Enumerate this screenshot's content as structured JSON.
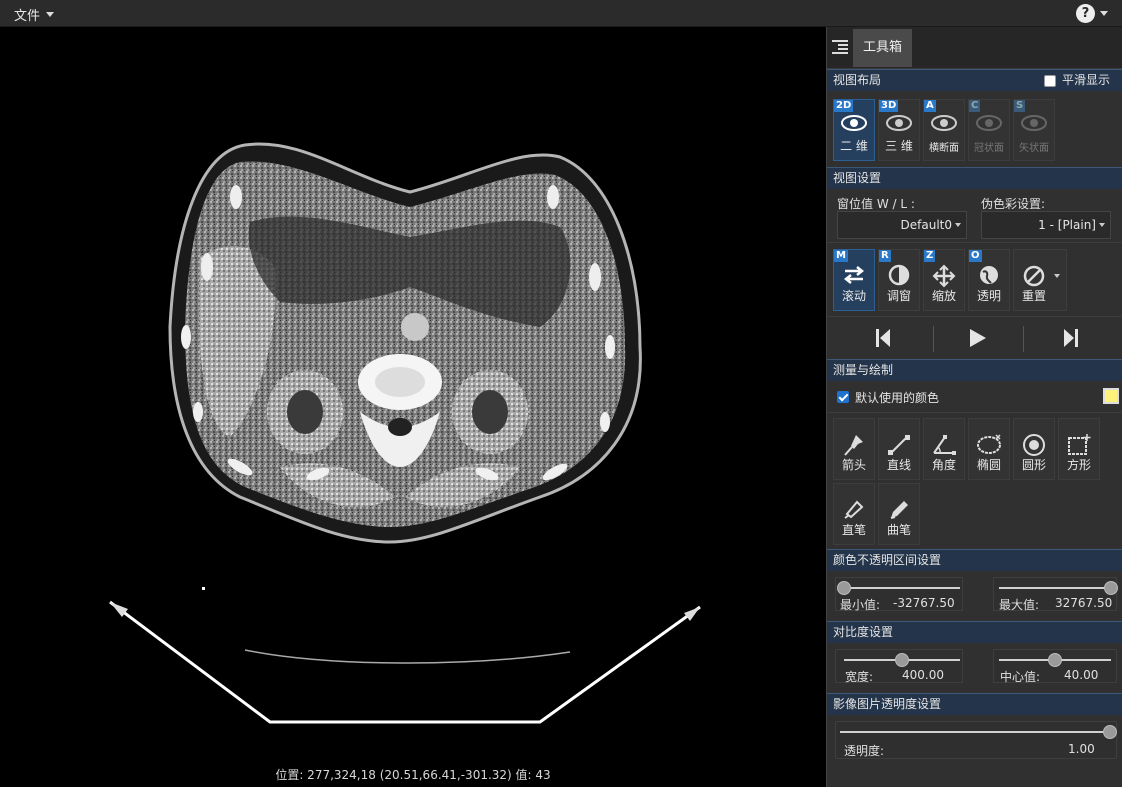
{
  "menubar": {
    "file_label": "文件",
    "help_icon": "question-circle-icon"
  },
  "viewer": {
    "status_text": "位置: 277,324,18 (20.51,66.41,-301.32) 值: 43"
  },
  "panel": {
    "tab_label": "工具箱",
    "view_layout": {
      "title": "视图布局",
      "smooth_label": "平滑显示",
      "smooth_checked": false,
      "modes": [
        {
          "badge": "2D",
          "label": "二 维",
          "icon": "eye-icon",
          "active": true,
          "enabled": true
        },
        {
          "badge": "3D",
          "label": "三 维",
          "icon": "eye-icon",
          "active": false,
          "enabled": true
        },
        {
          "badge": "A",
          "label": "横断面",
          "icon": "eye-icon",
          "active": false,
          "enabled": true
        },
        {
          "badge": "C",
          "label": "冠状面",
          "icon": "eye-icon",
          "active": false,
          "enabled": false
        },
        {
          "badge": "S",
          "label": "矢状面",
          "icon": "eye-icon",
          "active": false,
          "enabled": false
        }
      ]
    },
    "view_settings": {
      "title": "视图设置",
      "wl_label": "窗位值 W / L :",
      "wl_value": "Default0",
      "color_label": "伪色彩设置:",
      "color_value": "1 - [Plain]",
      "tools": [
        {
          "badge": "M",
          "label": "滚动",
          "icon": "scroll-arrows-icon",
          "active": true
        },
        {
          "badge": "R",
          "label": "调窗",
          "icon": "contrast-icon",
          "active": false
        },
        {
          "badge": "Z",
          "label": "缩放",
          "icon": "move-arrows-icon",
          "active": false
        },
        {
          "badge": "O",
          "label": "透明",
          "icon": "globe-icon",
          "active": false
        },
        {
          "badge": "",
          "label": "重置",
          "icon": "reset-icon",
          "active": false
        }
      ]
    },
    "playback": {
      "prev_icon": "skip-back-icon",
      "play_icon": "play-icon",
      "next_icon": "skip-forward-icon"
    },
    "measure": {
      "title": "测量与绘制",
      "default_color_label": "默认使用的颜色",
      "default_color_checked": true,
      "color": "#fff27a",
      "tools": [
        {
          "label": "箭头",
          "icon": "pin-icon"
        },
        {
          "label": "直线",
          "icon": "line-icon"
        },
        {
          "label": "角度",
          "icon": "angle-icon"
        },
        {
          "label": "椭圆",
          "icon": "ellipse-icon"
        },
        {
          "label": "圆形",
          "icon": "circle-icon"
        },
        {
          "label": "方形",
          "icon": "square-icon"
        },
        {
          "label": "直笔",
          "icon": "pen-nib-icon"
        },
        {
          "label": "曲笔",
          "icon": "pencil-icon"
        }
      ]
    },
    "opacity_range": {
      "title": "颜色不透明区间设置",
      "min_label": "最小值:",
      "min_value": "-32767.50",
      "max_label": "最大值:",
      "max_value": "32767.50",
      "min_fraction": 0.0,
      "max_fraction": 1.0
    },
    "contrast": {
      "title": "对比度设置",
      "width_label": "宽度:",
      "width_value": "400.00",
      "center_label": "中心值:",
      "center_value": "40.00",
      "width_fraction": 0.5,
      "center_fraction": 0.5
    },
    "image_opacity": {
      "title": "影像图片透明度设置",
      "label": "透明度:",
      "value": "1.00",
      "fraction": 1.0
    }
  }
}
